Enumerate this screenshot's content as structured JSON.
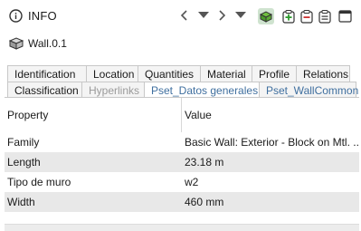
{
  "panel": {
    "title": "INFO"
  },
  "entity": {
    "name": "Wall.0.1"
  },
  "tabs_row1": [
    "Identification",
    "Location",
    "Quantities",
    "Material",
    "Profile",
    "Relations"
  ],
  "tabs_row2": [
    {
      "label": "Classification",
      "style": "normal"
    },
    {
      "label": "Hyperlinks",
      "style": "dim"
    },
    {
      "label": "Pset_Datos generales",
      "style": "blue",
      "selected": true
    },
    {
      "label": "Pset_WallCommon",
      "style": "blue"
    }
  ],
  "table": {
    "headers": {
      "property": "Property",
      "value": "Value"
    },
    "rows": [
      {
        "property": "Family",
        "value": "Basic Wall: Exterior - Block on Mtl. ..."
      },
      {
        "property": "Length",
        "value": "23.18 m"
      },
      {
        "property": "Tipo de muro",
        "value": "w2"
      },
      {
        "property": "Width",
        "value": "460 mm"
      }
    ]
  },
  "colors": {
    "active_tool_bg": "#cfe3cf",
    "tab_blue": "#3f6f9f",
    "alt_row": "#e8e8e8"
  }
}
